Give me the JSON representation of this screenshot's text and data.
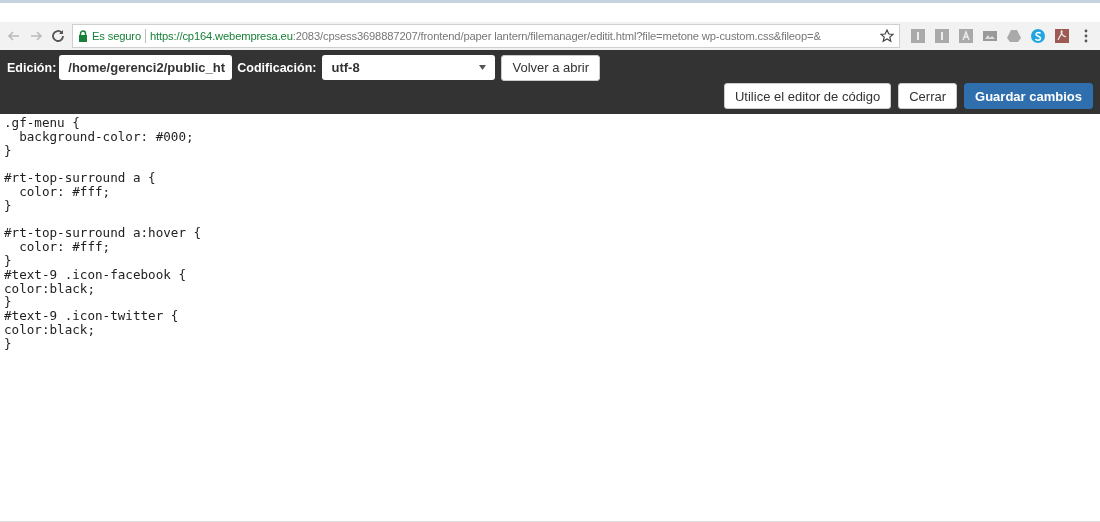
{
  "browser": {
    "security_label": "Es seguro",
    "url_host": "https://cp164.webempresa.eu",
    "url_path": ":2083/cpsess3698887207/frontend/paper lantern/filemanager/editit.html?file=metone wp-custom.css&fileop=&"
  },
  "toolbar": {
    "edit_label": "Edición:",
    "path_value": "/home/gerenci2/public_ht",
    "encoding_label": "Codificación:",
    "encoding_value": "utf-8",
    "reopen_button": "Volver a abrir",
    "buttons": [
      {
        "label": "Utilice el editor de código",
        "kind": "default"
      },
      {
        "label": "Cerrar",
        "kind": "default"
      },
      {
        "label": "Guardar cambios",
        "kind": "primary"
      }
    ]
  },
  "code": ".gf-menu {\n  background-color: #000;\n}\n\n#rt-top-surround a {\n  color: #fff;\n}\n\n#rt-top-surround a:hover {\n  color: #fff;\n}\n#text-9 .icon-facebook {\ncolor:black;\n}\n#text-9 .icon-twitter {\ncolor:black;\n}"
}
